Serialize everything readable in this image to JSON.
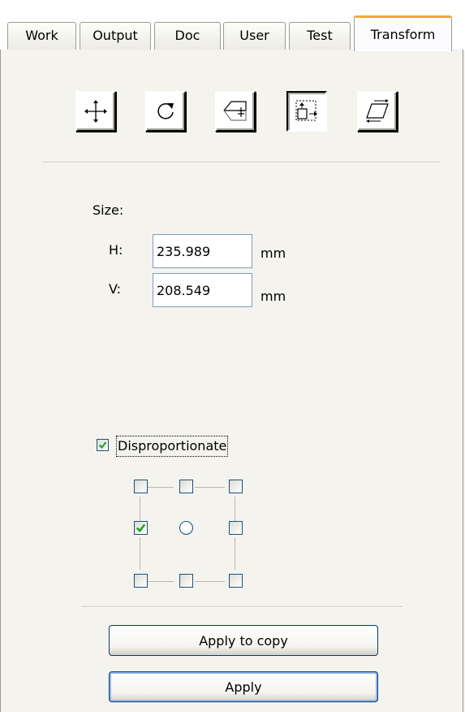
{
  "tabs": [
    {
      "label": "Work",
      "active": false
    },
    {
      "label": "Output",
      "active": false
    },
    {
      "label": "Doc",
      "active": false
    },
    {
      "label": "User",
      "active": false
    },
    {
      "label": "Test",
      "active": false
    },
    {
      "label": "Transform",
      "active": true
    }
  ],
  "tools": [
    {
      "icon": "move-icon",
      "pressed": false
    },
    {
      "icon": "rotate-icon",
      "pressed": false
    },
    {
      "icon": "mirror-icon",
      "pressed": false
    },
    {
      "icon": "scale-icon",
      "pressed": true
    },
    {
      "icon": "skew-icon",
      "pressed": false
    }
  ],
  "size": {
    "heading": "Size:",
    "h_label": "H:",
    "h_value": "235.989",
    "h_unit": "mm",
    "v_label": "V:",
    "v_value": "208.549",
    "v_unit": "mm"
  },
  "disproportionate": {
    "label": "Disproportionate",
    "checked": true
  },
  "anchor": {
    "selected": "middle-left"
  },
  "buttons": {
    "apply_copy": "Apply to copy",
    "apply": "Apply"
  },
  "colors": {
    "active_tab_accent": "#f2a83c",
    "check_mark": "#21a121",
    "field_border": "#7f9db9",
    "button_border": "#003c74"
  }
}
